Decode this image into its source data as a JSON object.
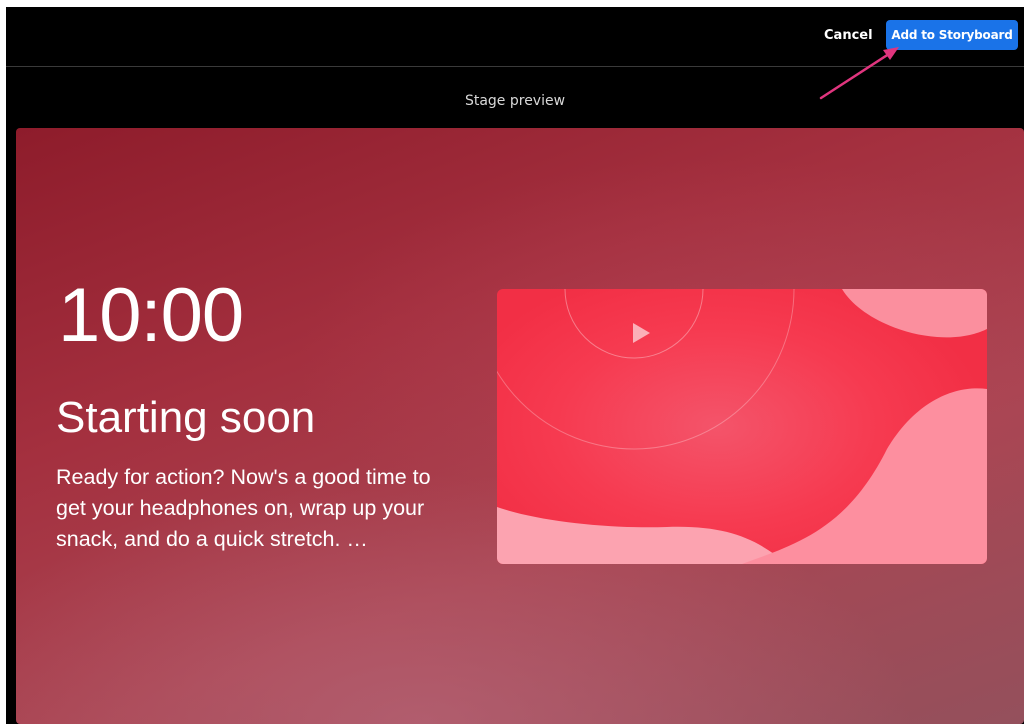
{
  "toolbar": {
    "cancel_label": "Cancel",
    "add_label": "Add to Storyboard"
  },
  "preview": {
    "label": "Stage preview"
  },
  "stage": {
    "timer": "10:00",
    "headline": "Starting soon",
    "body": "Ready for action? Now's a good time to get your headphones on, wrap up your snack, and do a quick stretch. …"
  },
  "icons": {
    "arrow": "pointer-arrow-icon",
    "play": "play-icon"
  },
  "colors": {
    "accent": "#1a73e8",
    "stage_base": "#a4303f",
    "thumb_base": "#f63a50",
    "annotation_arrow": "#e0357e"
  }
}
